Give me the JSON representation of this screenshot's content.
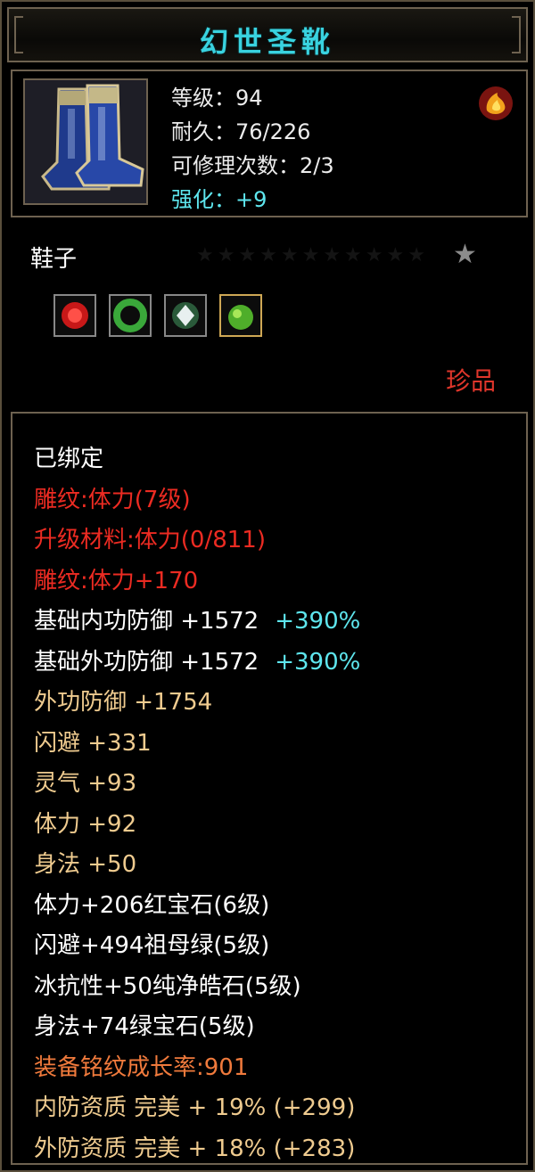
{
  "title": "幻世圣靴",
  "header": {
    "level": "等级：94",
    "durability": "耐久：76/226",
    "repair": "可修理次数：2/3",
    "enhance": "强化：+9"
  },
  "kind": "鞋子",
  "rarity": "珍品",
  "icons": {
    "item": "boots-icon",
    "top_right": "fire-emblem-icon",
    "gems": [
      "red-gem-icon",
      "green-ring-gem-icon",
      "diamond-gem-icon",
      "green-gem-icon"
    ],
    "star": "star-icon"
  },
  "lines": {
    "bound": "已绑定",
    "engrave": "雕纹:体力(7级)",
    "upgrade": "升级材料:体力(0/811)",
    "engrave_bonus": "雕纹:体力+170",
    "inner_def_label": "基础内功防御 +1572",
    "inner_def_pct": "+390%",
    "outer_def_label": "基础外功防御 +1572",
    "outer_def_pct": "+390%",
    "outer_def": "外功防御 +1754",
    "dodge": "闪避 +331",
    "spirit": "灵气 +93",
    "stamina": "体力 +92",
    "agility": "身法 +50",
    "gem1": "体力+206红宝石(6级)",
    "gem2": "闪避+494祖母绿(5级)",
    "gem3": "冰抗性+50纯净皓石(5级)",
    "gem4": "身法+74绿宝石(5级)",
    "growth": "装备铭纹成长率:901",
    "inner_quality": "内防资质 完美 + 19% (+299)",
    "outer_quality": "外防资质 完美 + 18% (+283)"
  },
  "colors": {
    "title": "#39d3e0",
    "red": "#ec2b22",
    "gold": "#efcb8f",
    "orange": "#f07a3c",
    "cyan": "#5ee6ee",
    "border": "#6e6250"
  }
}
